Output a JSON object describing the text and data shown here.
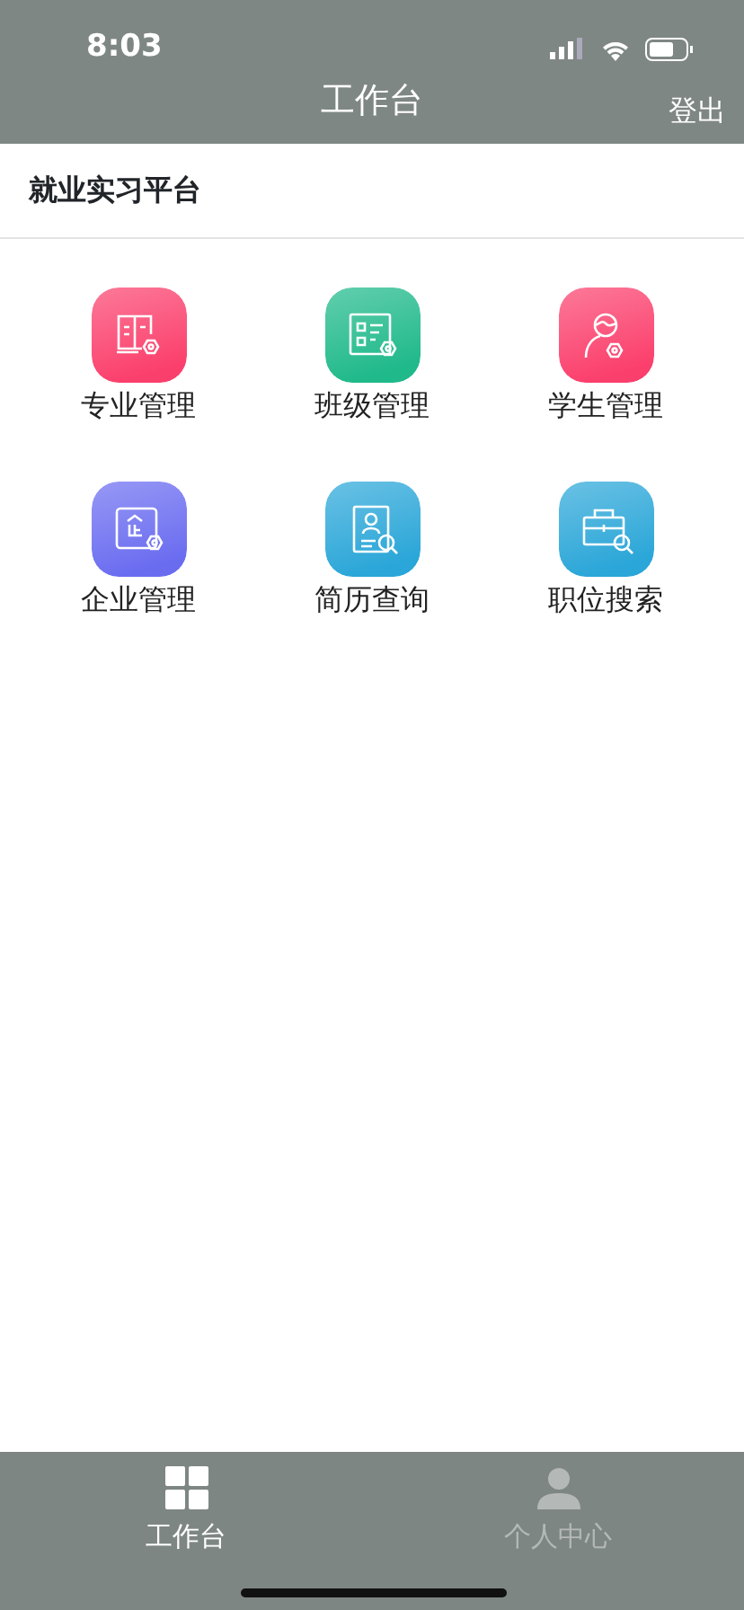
{
  "status_bar": {
    "time": "8:03"
  },
  "nav_bar": {
    "title": "工作台",
    "action": "登出"
  },
  "section": {
    "title": "就业实习平台"
  },
  "tiles": [
    {
      "label": "专业管理",
      "color": "#fb3f6c"
    },
    {
      "label": "班级管理",
      "color": "#1fb98a"
    },
    {
      "label": "学生管理",
      "color": "#fb3f6c"
    },
    {
      "label": "企业管理",
      "color": "#6a6cf0"
    },
    {
      "label": "简历查询",
      "color": "#2aa6d8"
    },
    {
      "label": "职位搜索",
      "color": "#2aa6d8"
    }
  ],
  "tab_bar": [
    {
      "label": "工作台",
      "selected": true
    },
    {
      "label": "个人中心",
      "selected": false
    }
  ]
}
